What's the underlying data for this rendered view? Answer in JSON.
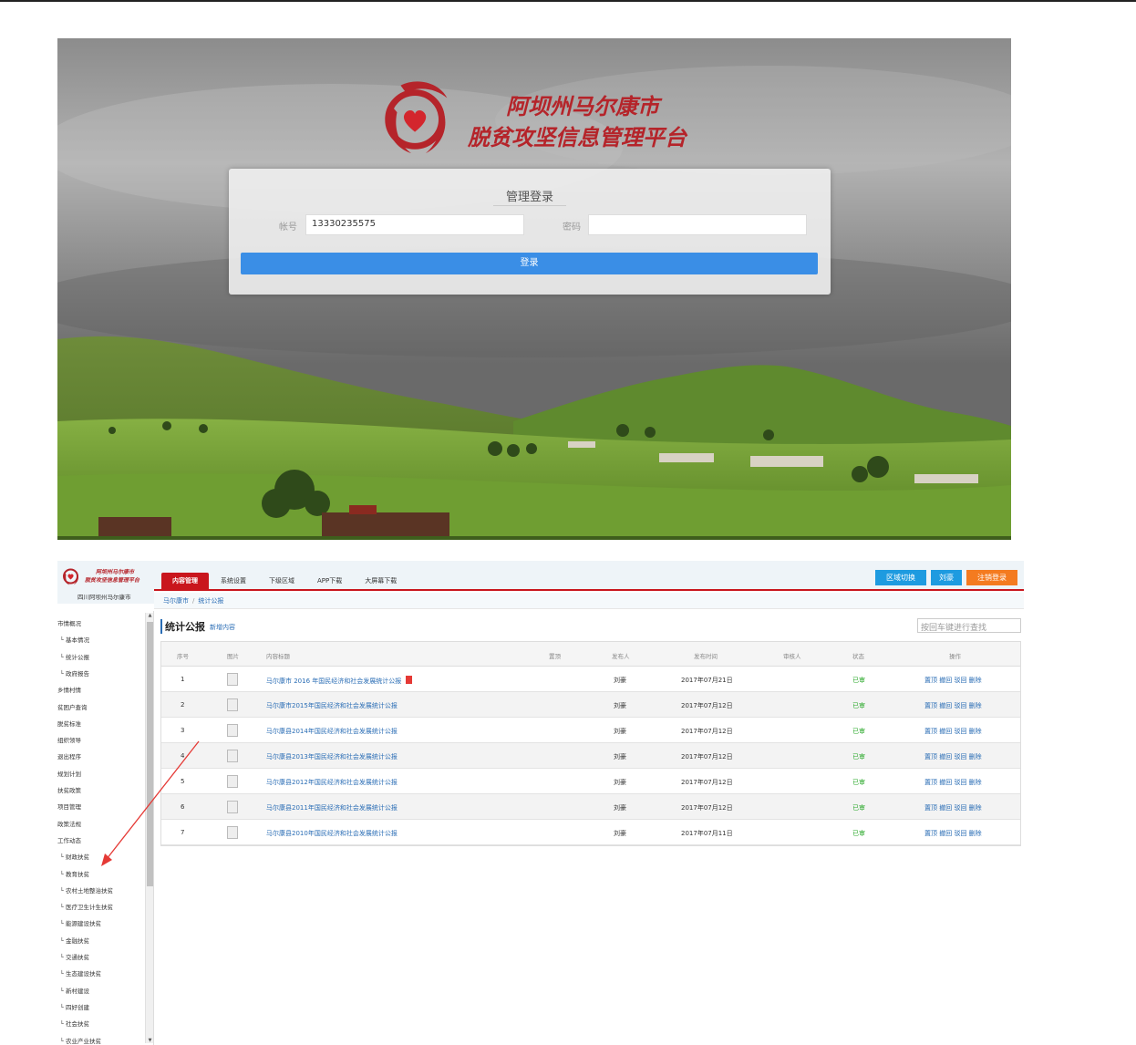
{
  "login": {
    "logo_line1": "阿坝州马尔康市",
    "logo_line2": "脱贫攻坚信息管理平台",
    "panel_title": "管理登录",
    "account_label": "帐号",
    "account_value": "13330235575",
    "password_label": "密码",
    "password_value": "",
    "submit_label": "登录"
  },
  "admin": {
    "logo_line1": "阿坝州马尔康市",
    "logo_line2": "脱贫攻坚信息管理平台",
    "org": "四川阿坝州马尔康市",
    "nav": [
      "内容管理",
      "系统设置",
      "下级区域",
      "APP下载",
      "大屏幕下载"
    ],
    "btn_region": "区域切换",
    "btn_user": "刘豪",
    "btn_logout": "注销登录",
    "breadcrumb": [
      "马尔康市",
      "统计公报"
    ],
    "page_title": "统计公报",
    "add_link": "新增内容",
    "search_placeholder": "按回车键进行查找",
    "sidebar": [
      {
        "label": "市情概况",
        "sub": false
      },
      {
        "label": "└ 基本情况",
        "sub": true
      },
      {
        "label": "└ 统计公报",
        "sub": true
      },
      {
        "label": "└ 政府报告",
        "sub": true
      },
      {
        "label": "乡情村情",
        "sub": false
      },
      {
        "label": "贫困户查询",
        "sub": false
      },
      {
        "label": "脱贫标准",
        "sub": false
      },
      {
        "label": "组织领导",
        "sub": false
      },
      {
        "label": "退出程序",
        "sub": false
      },
      {
        "label": "规划计划",
        "sub": false
      },
      {
        "label": "扶贫政策",
        "sub": false
      },
      {
        "label": "项目管理",
        "sub": false
      },
      {
        "label": "政策法规",
        "sub": false
      },
      {
        "label": "工作动态",
        "sub": false
      },
      {
        "label": "└ 财政扶贫",
        "sub": true
      },
      {
        "label": "└ 教育扶贫",
        "sub": true
      },
      {
        "label": "└ 农村土地整治扶贫",
        "sub": true
      },
      {
        "label": "└ 医疗卫生计生扶贫",
        "sub": true
      },
      {
        "label": "└ 能源建设扶贫",
        "sub": true
      },
      {
        "label": "└ 金融扶贫",
        "sub": true
      },
      {
        "label": "└ 交通扶贫",
        "sub": true
      },
      {
        "label": "└ 生态建设扶贫",
        "sub": true
      },
      {
        "label": "└ 新村建设",
        "sub": true
      },
      {
        "label": "└ 四好创建",
        "sub": true
      },
      {
        "label": "└ 社会扶贫",
        "sub": true
      },
      {
        "label": "└ 农业产业扶贫",
        "sub": true
      }
    ],
    "table": {
      "headers": [
        "序号",
        "图片",
        "内容标题",
        "置顶",
        "发布人",
        "发布时间",
        "审核人",
        "状态",
        "操作"
      ],
      "rows": [
        {
          "no": "1",
          "title": "马尔康市 2016 年国民经济和社会发展统计公报",
          "pdf": true,
          "author": "刘豪",
          "date": "2017年07月21日",
          "status": "已审",
          "ops": "置顶 撤回 驳回 删除"
        },
        {
          "no": "2",
          "title": "马尔康市2015年国民经济和社会发展统计公报",
          "pdf": false,
          "author": "刘豪",
          "date": "2017年07月12日",
          "status": "已审",
          "ops": "置顶 撤回 驳回 删除"
        },
        {
          "no": "3",
          "title": "马尔康县2014年国民经济和社会发展统计公报",
          "pdf": false,
          "author": "刘豪",
          "date": "2017年07月12日",
          "status": "已审",
          "ops": "置顶 撤回 驳回 删除"
        },
        {
          "no": "4",
          "title": "马尔康县2013年国民经济和社会发展统计公报",
          "pdf": false,
          "author": "刘豪",
          "date": "2017年07月12日",
          "status": "已审",
          "ops": "置顶 撤回 驳回 删除"
        },
        {
          "no": "5",
          "title": "马尔康县2012年国民经济和社会发展统计公报",
          "pdf": false,
          "author": "刘豪",
          "date": "2017年07月12日",
          "status": "已审",
          "ops": "置顶 撤回 驳回 删除"
        },
        {
          "no": "6",
          "title": "马尔康县2011年国民经济和社会发展统计公报",
          "pdf": false,
          "author": "刘豪",
          "date": "2017年07月12日",
          "status": "已审",
          "ops": "置顶 撤回 驳回 删除"
        },
        {
          "no": "7",
          "title": "马尔康县2010年国民经济和社会发展统计公报",
          "pdf": false,
          "author": "刘豪",
          "date": "2017年07月11日",
          "status": "已审",
          "ops": "置顶 撤回 驳回 删除"
        }
      ]
    }
  },
  "colors": {
    "brand_red": "#c9161d",
    "link_blue": "#2a6db5",
    "login_button": "#3a8ee6",
    "btn_region": "#1e9be0",
    "btn_user": "#1e9be0",
    "btn_logout": "#f47b20",
    "status_green": "#2aa82a",
    "annotation_arrow": "#e53935"
  }
}
